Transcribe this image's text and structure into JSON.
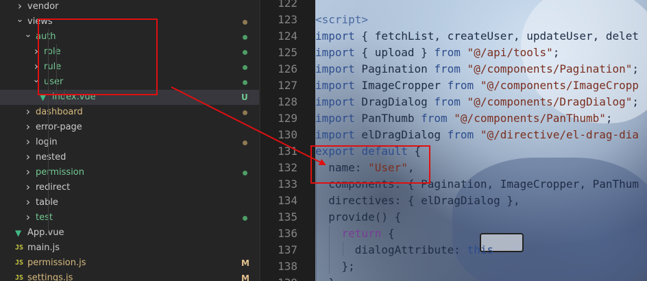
{
  "explorer": {
    "items": [
      {
        "label": "vendor",
        "type": "folder",
        "collapsed": true,
        "color": "plain",
        "badge": null
      },
      {
        "label": "views",
        "type": "folder",
        "collapsed": false,
        "color": "plain",
        "badge": "dot-orange"
      },
      {
        "label": "auth",
        "type": "folder",
        "collapsed": false,
        "color": "green",
        "badge": "dot-green"
      },
      {
        "label": "role",
        "type": "folder",
        "collapsed": true,
        "color": "green",
        "badge": "dot-green"
      },
      {
        "label": "rule",
        "type": "folder",
        "collapsed": true,
        "color": "green",
        "badge": "dot-green"
      },
      {
        "label": "user",
        "type": "folder",
        "collapsed": false,
        "color": "green",
        "badge": "dot-green"
      },
      {
        "label": "index.vue",
        "type": "vue",
        "collapsed": null,
        "color": "green",
        "badge": "U"
      },
      {
        "label": "dashboard",
        "type": "folder",
        "collapsed": true,
        "color": "orange",
        "badge": "dot-orange"
      },
      {
        "label": "error-page",
        "type": "folder",
        "collapsed": true,
        "color": "plain",
        "badge": null
      },
      {
        "label": "login",
        "type": "folder",
        "collapsed": true,
        "color": "plain",
        "badge": "dot-orange"
      },
      {
        "label": "nested",
        "type": "folder",
        "collapsed": true,
        "color": "plain",
        "badge": null
      },
      {
        "label": "permission",
        "type": "folder",
        "collapsed": true,
        "color": "green",
        "badge": "dot-green"
      },
      {
        "label": "redirect",
        "type": "folder",
        "collapsed": true,
        "color": "plain",
        "badge": null
      },
      {
        "label": "table",
        "type": "folder",
        "collapsed": true,
        "color": "plain",
        "badge": null
      },
      {
        "label": "test",
        "type": "folder",
        "collapsed": true,
        "color": "green",
        "badge": "dot-green"
      },
      {
        "label": "App.vue",
        "type": "vue",
        "collapsed": null,
        "color": "plain",
        "badge": null
      },
      {
        "label": "main.js",
        "type": "js",
        "collapsed": null,
        "color": "plain",
        "badge": null
      },
      {
        "label": "permission.js",
        "type": "js",
        "collapsed": null,
        "color": "orange",
        "badge": "M"
      },
      {
        "label": "settings.js",
        "type": "js",
        "collapsed": null,
        "color": "orange",
        "badge": "M"
      }
    ],
    "icon_text": {
      "js": "JS",
      "vue": "▼"
    },
    "colors": {
      "green": "#73c991",
      "orange": "#d7ba7d",
      "untracked": "#73c991",
      "modified": "#e2c08d"
    }
  },
  "editor": {
    "lines": [
      {
        "num": "122",
        "tokens": []
      },
      {
        "num": "123",
        "tokens": [
          [
            "tag",
            "<script>"
          ]
        ]
      },
      {
        "num": "124",
        "tokens": [
          [
            "kw",
            "import"
          ],
          [
            "ident",
            " { fetchList, createUser, updateUser, delet"
          ]
        ]
      },
      {
        "num": "125",
        "tokens": [
          [
            "kw",
            "import"
          ],
          [
            "ident",
            " { upload } "
          ],
          [
            "kw",
            "from"
          ],
          [
            "str",
            " \"@/api/tools\""
          ],
          [
            "ident",
            ";"
          ]
        ]
      },
      {
        "num": "126",
        "tokens": [
          [
            "kw",
            "import"
          ],
          [
            "ident",
            " Pagination "
          ],
          [
            "kw",
            "from"
          ],
          [
            "str",
            " \"@/components/Pagination\""
          ],
          [
            "ident",
            ";"
          ]
        ]
      },
      {
        "num": "127",
        "tokens": [
          [
            "kw",
            "import"
          ],
          [
            "ident",
            " ImageCropper "
          ],
          [
            "kw",
            "from"
          ],
          [
            "str",
            " \"@/components/ImageCropp"
          ]
        ]
      },
      {
        "num": "128",
        "tokens": [
          [
            "kw",
            "import"
          ],
          [
            "ident",
            " DragDialog "
          ],
          [
            "kw",
            "from"
          ],
          [
            "str",
            " \"@/components/DragDialog\""
          ],
          [
            "ident",
            ";"
          ]
        ]
      },
      {
        "num": "129",
        "tokens": [
          [
            "kw",
            "import"
          ],
          [
            "ident",
            " PanThumb "
          ],
          [
            "kw",
            "from"
          ],
          [
            "str",
            " \"@/components/PanThumb\""
          ],
          [
            "ident",
            ";"
          ]
        ]
      },
      {
        "num": "130",
        "tokens": [
          [
            "kw",
            "import"
          ],
          [
            "ident",
            " elDragDialog "
          ],
          [
            "kw",
            "from"
          ],
          [
            "str",
            " \"@/directive/el-drag-dia"
          ]
        ]
      },
      {
        "num": "131",
        "tokens": [
          [
            "kw",
            "export"
          ],
          [
            "ident",
            " "
          ],
          [
            "kw",
            "default"
          ],
          [
            "ident",
            " {"
          ]
        ]
      },
      {
        "num": "132",
        "tokens": [
          [
            "ident",
            "  name: "
          ],
          [
            "str",
            "\"User\""
          ],
          [
            "ident",
            ","
          ]
        ]
      },
      {
        "num": "133",
        "tokens": [
          [
            "ident",
            "  components: { Pagination, ImageCropper, PanThum"
          ]
        ]
      },
      {
        "num": "134",
        "tokens": [
          [
            "ident",
            "  directives: { elDragDialog },"
          ]
        ]
      },
      {
        "num": "135",
        "tokens": [
          [
            "ident",
            "  provide() {"
          ]
        ]
      },
      {
        "num": "136",
        "tokens": [
          [
            "ident",
            "    "
          ],
          [
            "kw2",
            "return"
          ],
          [
            "ident",
            " {"
          ]
        ]
      },
      {
        "num": "137",
        "tokens": [
          [
            "ident",
            "      dialogAttribute: "
          ],
          [
            "kw",
            "this"
          ]
        ]
      },
      {
        "num": "138",
        "tokens": [
          [
            "ident",
            "    };"
          ]
        ]
      },
      {
        "num": "139",
        "tokens": [
          [
            "ident",
            "  },"
          ]
        ]
      }
    ]
  }
}
